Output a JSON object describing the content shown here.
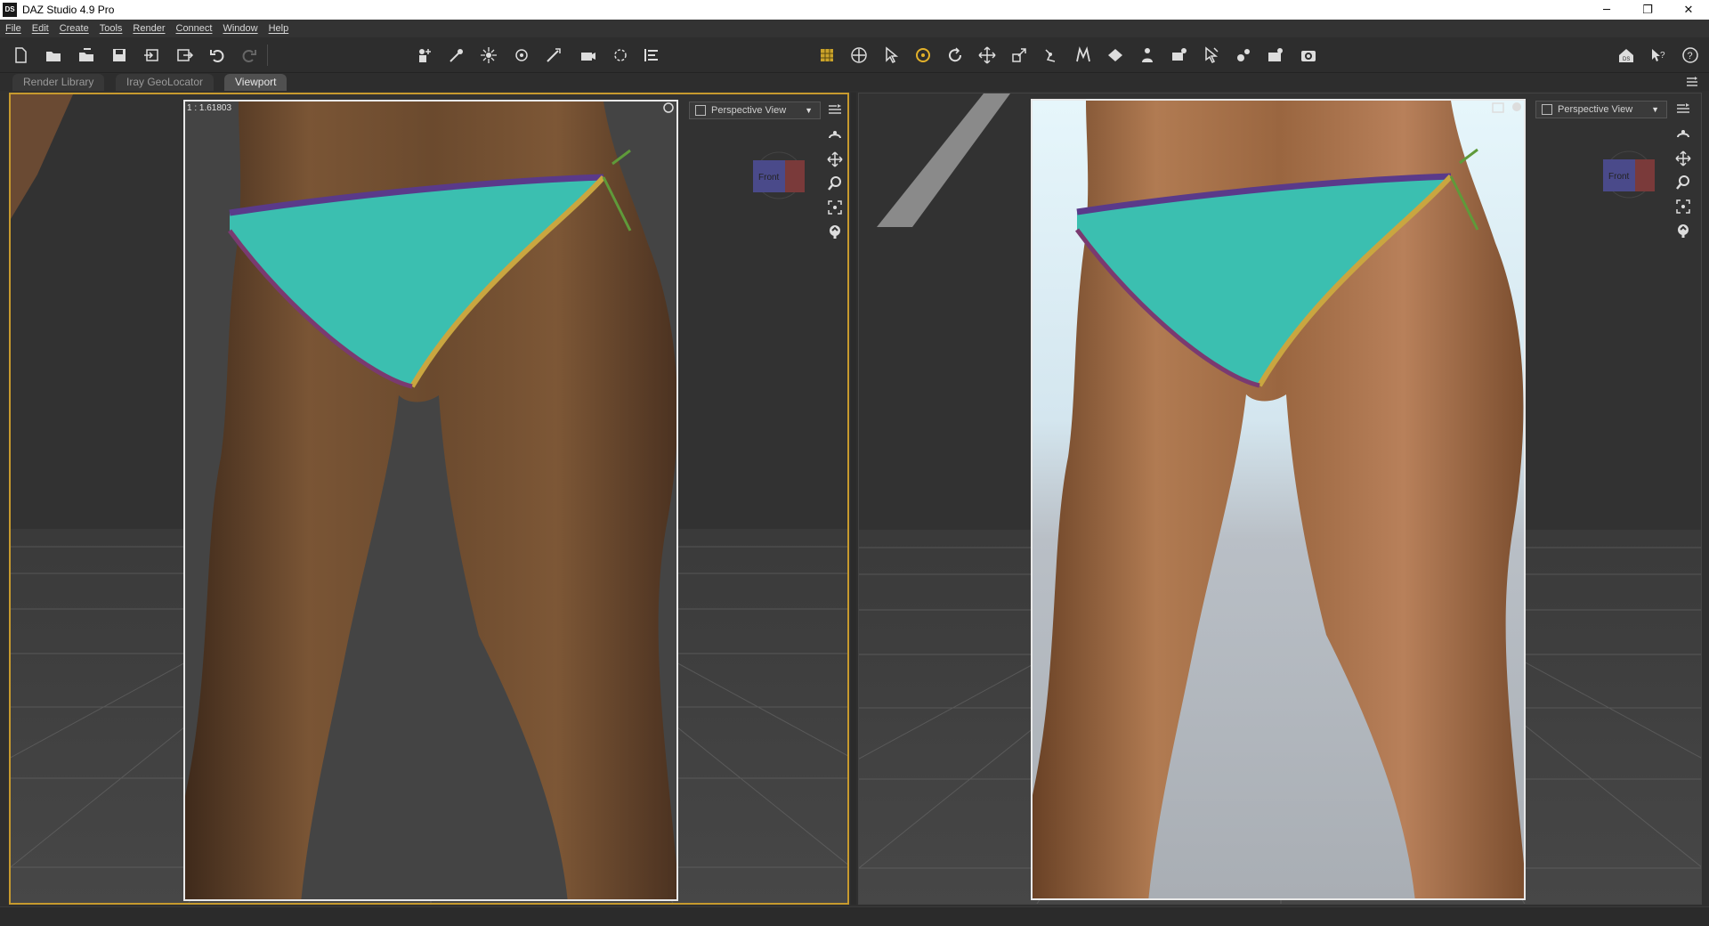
{
  "window": {
    "title": "DAZ Studio 4.9 Pro",
    "app_icon_text": "DS",
    "minimize": "─",
    "maximize": "❐",
    "close": "✕"
  },
  "menu": [
    "File",
    "Edit",
    "Create",
    "Tools",
    "Render",
    "Connect",
    "Window",
    "Help"
  ],
  "toolbar": {
    "file_tools": [
      "new-scene-icon",
      "open-icon",
      "merge-icon",
      "save-icon",
      "import-icon",
      "export-icon",
      "undo-icon",
      "redo-icon"
    ],
    "create_tools": [
      "new-figure-icon",
      "spotlight-icon",
      "point-light-icon",
      "distant-light-icon",
      "linear-light-icon",
      "camera-tool-icon",
      "node-icon",
      "align-icon"
    ],
    "transform_tools": [
      "surface-selection-icon",
      "universal-tool-icon",
      "node-selection-icon",
      "rotate-tool-icon",
      "rotate-icon",
      "translate-icon",
      "scale-icon",
      "joint-editor-icon",
      "morph-icon",
      "geometry-editor-icon",
      "figure-setup-icon",
      "active-pose-icon",
      "spot-render-icon",
      "pose-tool-icon",
      "render-settings-icon",
      "render-icon"
    ],
    "right_tools": [
      "daz-home-icon",
      "whats-this-icon",
      "help-icon"
    ]
  },
  "tabs": {
    "items": [
      "Render Library",
      "Iray GeoLocator",
      "Viewport"
    ],
    "active": "Viewport"
  },
  "viewports": {
    "left": {
      "aspect": "1 : 1.61803",
      "view": "Perspective View",
      "cube_label": "Front"
    },
    "right": {
      "view": "Perspective View",
      "cube_label": "Front"
    }
  },
  "colors": {
    "active_border": "#c79a2e",
    "bikini": "#3bbfb0",
    "skin_left": "#7a5535",
    "skin_right": "#a8734d"
  }
}
